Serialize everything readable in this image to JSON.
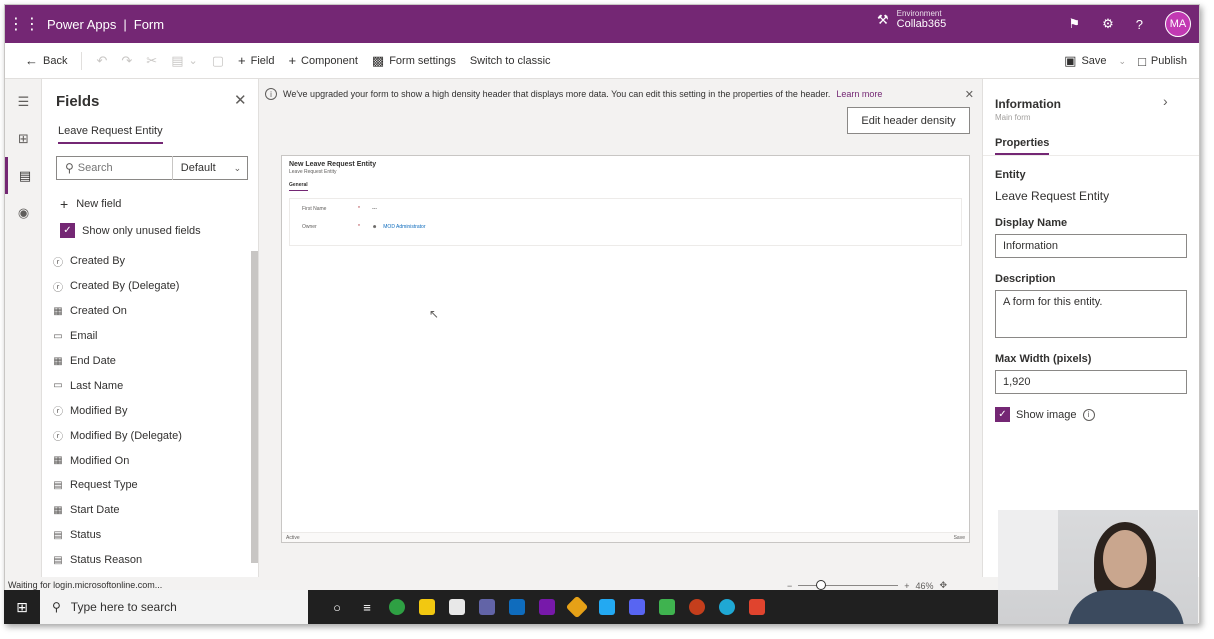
{
  "topbar": {
    "app_name": "Power Apps",
    "page": "Form",
    "environment_label": "Environment",
    "environment_name": "Collab365",
    "avatar_initials": "MA",
    "accent_color": "#742774"
  },
  "commandbar": {
    "back": "Back",
    "add_field": "Field",
    "add_component": "Component",
    "form_settings": "Form settings",
    "switch_classic": "Switch to classic",
    "save": "Save",
    "publish": "Publish"
  },
  "fields_pane": {
    "title": "Fields",
    "entity_tab": "Leave Request Entity",
    "search_placeholder": "Search",
    "filter_value": "Default",
    "new_field": "New field",
    "show_unused": "Show only unused fields",
    "items": [
      {
        "label": "Created By",
        "icon": "lookup-icon"
      },
      {
        "label": "Created By (Delegate)",
        "icon": "lookup-icon"
      },
      {
        "label": "Created On",
        "icon": "calendar-icon"
      },
      {
        "label": "Email",
        "icon": "text-field-icon"
      },
      {
        "label": "End Date",
        "icon": "calendar-icon"
      },
      {
        "label": "Last Name",
        "icon": "text-field-icon"
      },
      {
        "label": "Modified By",
        "icon": "lookup-icon"
      },
      {
        "label": "Modified By (Delegate)",
        "icon": "lookup-icon"
      },
      {
        "label": "Modified On",
        "icon": "calendar-icon"
      },
      {
        "label": "Request Type",
        "icon": "choice-icon"
      },
      {
        "label": "Start Date",
        "icon": "calendar-icon"
      },
      {
        "label": "Status",
        "icon": "choice-icon"
      },
      {
        "label": "Status Reason",
        "icon": "choice-icon"
      }
    ]
  },
  "canvas": {
    "banner_text": "We've upgraded your form to show a high density header that displays more data. You can edit this setting in the properties of the header.",
    "banner_link": "Learn more",
    "edit_density": "Edit header density",
    "form_title": "New Leave Request Entity",
    "form_subtitle": "Leave Request Entity",
    "form_tab": "General",
    "fields": [
      {
        "label": "First Name",
        "req": "*",
        "value": "---"
      },
      {
        "label": "Owner",
        "req": "*",
        "value": "MOD Administrator"
      }
    ],
    "footer_left": "Active",
    "footer_right": "Save"
  },
  "properties": {
    "title": "Information",
    "subtitle": "Main form",
    "tab": "Properties",
    "entity_label": "Entity",
    "entity_value": "Leave Request Entity",
    "display_name_label": "Display Name",
    "display_name_value": "Information",
    "description_label": "Description",
    "description_value": "A form for this entity.",
    "max_width_label": "Max Width (pixels)",
    "max_width_value": "1,920",
    "show_image": "Show image"
  },
  "status": {
    "text": "Waiting for login.microsoftonline.com...",
    "zoom": "46%"
  },
  "taskbar": {
    "search_placeholder": "Type here to search"
  }
}
